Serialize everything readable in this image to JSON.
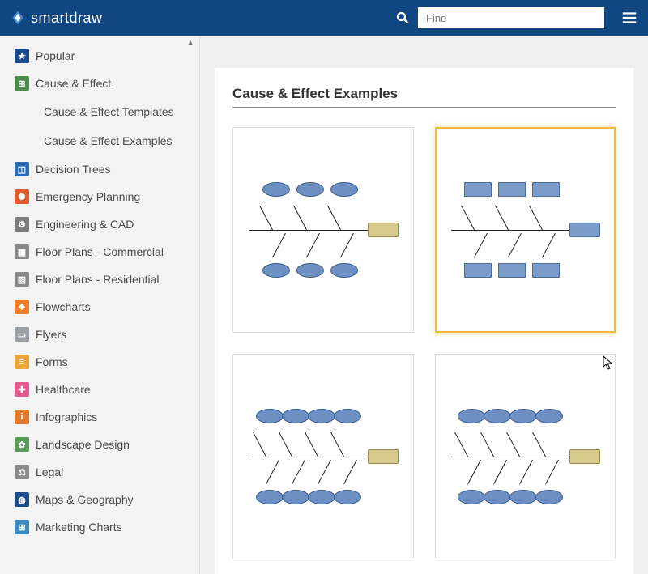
{
  "header": {
    "brand": "smartdraw",
    "search_placeholder": "Find"
  },
  "sidebar": {
    "items": [
      {
        "label": "Popular",
        "icon_bg": "#1b4b8a",
        "glyph": "★"
      },
      {
        "label": "Cause & Effect",
        "icon_bg": "#4b8a4b",
        "glyph": "⊞",
        "expanded": true,
        "children": [
          {
            "label": "Cause & Effect Templates"
          },
          {
            "label": "Cause & Effect Examples"
          }
        ]
      },
      {
        "label": "Decision Trees",
        "icon_bg": "#2a6ab5",
        "glyph": "◫"
      },
      {
        "label": "Emergency Planning",
        "icon_bg": "#e25b2e",
        "glyph": "✺"
      },
      {
        "label": "Engineering & CAD",
        "icon_bg": "#7c7c7c",
        "glyph": "⚙"
      },
      {
        "label": "Floor Plans - Commercial",
        "icon_bg": "#888888",
        "glyph": "▦"
      },
      {
        "label": "Floor Plans - Residential",
        "icon_bg": "#888888",
        "glyph": "▧"
      },
      {
        "label": "Flowcharts",
        "icon_bg": "#f07d2a",
        "glyph": "⬥"
      },
      {
        "label": "Flyers",
        "icon_bg": "#9aa0a6",
        "glyph": "▭"
      },
      {
        "label": "Forms",
        "icon_bg": "#e8a63a",
        "glyph": "≡"
      },
      {
        "label": "Healthcare",
        "icon_bg": "#e15a8f",
        "glyph": "✚"
      },
      {
        "label": "Infographics",
        "icon_bg": "#e07a2e",
        "glyph": "i"
      },
      {
        "label": "Landscape Design",
        "icon_bg": "#5a9a5a",
        "glyph": "✿"
      },
      {
        "label": "Legal",
        "icon_bg": "#8a8a8a",
        "glyph": "⚖"
      },
      {
        "label": "Maps & Geography",
        "icon_bg": "#1b4b8a",
        "glyph": "◍"
      },
      {
        "label": "Marketing Charts",
        "icon_bg": "#3a8ac0",
        "glyph": "⊞"
      }
    ]
  },
  "main": {
    "title": "Cause & Effect Examples",
    "templates": [
      {
        "name": "fishbone-example-1",
        "style": "ellipse",
        "selected": false
      },
      {
        "name": "fishbone-example-2",
        "style": "rect",
        "selected": true
      },
      {
        "name": "fishbone-example-3",
        "style": "ellipse-wide",
        "selected": false
      },
      {
        "name": "fishbone-example-4",
        "style": "ellipse-wide",
        "selected": false
      }
    ]
  }
}
